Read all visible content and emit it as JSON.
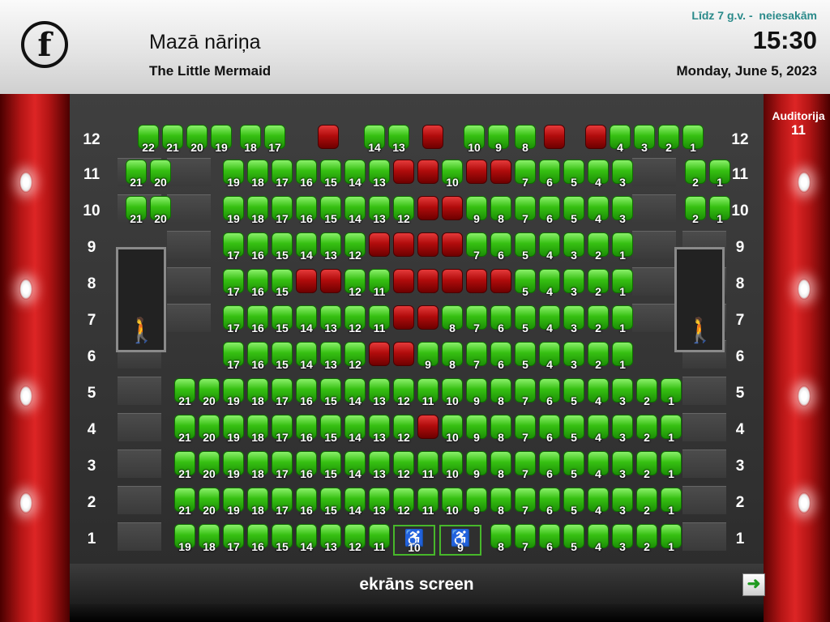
{
  "header": {
    "logo_letter": "f",
    "title_lv": "Mazā nāriņa",
    "title_en": "The Little Mermaid",
    "age_rating": "Līdz 7 g.v. -  neiesakām",
    "time": "15:30",
    "date": "Monday, June 5, 2023"
  },
  "auditorium": {
    "label": "Auditorija",
    "number": "11"
  },
  "screen_label": "ekrāns screen",
  "next_icon": "arrow-right-icon",
  "colors": {
    "available": "#36c012",
    "taken": "#b10c0c",
    "accent": "#2a8a8a"
  },
  "rows": [
    {
      "row": "12",
      "seats": [
        {
          "n": "22",
          "s": "free"
        },
        {
          "n": "21",
          "s": "free"
        },
        {
          "n": "20",
          "s": "free"
        },
        {
          "n": "19",
          "s": "free"
        },
        {
          "n": "18",
          "s": "free"
        },
        {
          "n": "17",
          "s": "free"
        },
        {
          "n": "",
          "s": "taken"
        },
        {
          "n": "14",
          "s": "free"
        },
        {
          "n": "13",
          "s": "free"
        },
        {
          "n": "",
          "s": "taken"
        },
        {
          "n": "10",
          "s": "free"
        },
        {
          "n": "9",
          "s": "free"
        },
        {
          "n": "8",
          "s": "free"
        },
        {
          "n": "",
          "s": "taken"
        },
        {
          "n": "",
          "s": "taken"
        },
        {
          "n": "4",
          "s": "free"
        },
        {
          "n": "3",
          "s": "free"
        },
        {
          "n": "2",
          "s": "free"
        },
        {
          "n": "1",
          "s": "free"
        }
      ]
    },
    {
      "row": "11",
      "seats": [
        {
          "n": "21",
          "s": "free"
        },
        {
          "n": "20",
          "s": "free"
        },
        {
          "n": "19",
          "s": "free"
        },
        {
          "n": "18",
          "s": "free"
        },
        {
          "n": "17",
          "s": "free"
        },
        {
          "n": "16",
          "s": "free"
        },
        {
          "n": "15",
          "s": "free"
        },
        {
          "n": "14",
          "s": "free"
        },
        {
          "n": "13",
          "s": "free"
        },
        {
          "n": "",
          "s": "taken"
        },
        {
          "n": "",
          "s": "taken"
        },
        {
          "n": "10",
          "s": "free"
        },
        {
          "n": "",
          "s": "taken"
        },
        {
          "n": "",
          "s": "taken"
        },
        {
          "n": "7",
          "s": "free"
        },
        {
          "n": "6",
          "s": "free"
        },
        {
          "n": "5",
          "s": "free"
        },
        {
          "n": "4",
          "s": "free"
        },
        {
          "n": "3",
          "s": "free"
        },
        {
          "n": "2",
          "s": "free"
        },
        {
          "n": "1",
          "s": "free"
        }
      ]
    },
    {
      "row": "10",
      "seats": [
        {
          "n": "21",
          "s": "free"
        },
        {
          "n": "20",
          "s": "free"
        },
        {
          "n": "19",
          "s": "free"
        },
        {
          "n": "18",
          "s": "free"
        },
        {
          "n": "17",
          "s": "free"
        },
        {
          "n": "16",
          "s": "free"
        },
        {
          "n": "15",
          "s": "free"
        },
        {
          "n": "14",
          "s": "free"
        },
        {
          "n": "13",
          "s": "free"
        },
        {
          "n": "12",
          "s": "free"
        },
        {
          "n": "",
          "s": "taken"
        },
        {
          "n": "",
          "s": "taken"
        },
        {
          "n": "9",
          "s": "free"
        },
        {
          "n": "8",
          "s": "free"
        },
        {
          "n": "7",
          "s": "free"
        },
        {
          "n": "6",
          "s": "free"
        },
        {
          "n": "5",
          "s": "free"
        },
        {
          "n": "4",
          "s": "free"
        },
        {
          "n": "3",
          "s": "free"
        },
        {
          "n": "2",
          "s": "free"
        },
        {
          "n": "1",
          "s": "free"
        }
      ]
    },
    {
      "row": "9",
      "seats": [
        {
          "n": "17",
          "s": "free"
        },
        {
          "n": "16",
          "s": "free"
        },
        {
          "n": "15",
          "s": "free"
        },
        {
          "n": "14",
          "s": "free"
        },
        {
          "n": "13",
          "s": "free"
        },
        {
          "n": "12",
          "s": "free"
        },
        {
          "n": "",
          "s": "taken"
        },
        {
          "n": "",
          "s": "taken"
        },
        {
          "n": "",
          "s": "taken"
        },
        {
          "n": "",
          "s": "taken"
        },
        {
          "n": "7",
          "s": "free"
        },
        {
          "n": "6",
          "s": "free"
        },
        {
          "n": "5",
          "s": "free"
        },
        {
          "n": "4",
          "s": "free"
        },
        {
          "n": "3",
          "s": "free"
        },
        {
          "n": "2",
          "s": "free"
        },
        {
          "n": "1",
          "s": "free"
        }
      ]
    },
    {
      "row": "8",
      "seats": [
        {
          "n": "17",
          "s": "free"
        },
        {
          "n": "16",
          "s": "free"
        },
        {
          "n": "15",
          "s": "free"
        },
        {
          "n": "",
          "s": "taken"
        },
        {
          "n": "",
          "s": "taken"
        },
        {
          "n": "12",
          "s": "free"
        },
        {
          "n": "11",
          "s": "free"
        },
        {
          "n": "",
          "s": "taken"
        },
        {
          "n": "",
          "s": "taken"
        },
        {
          "n": "",
          "s": "taken"
        },
        {
          "n": "",
          "s": "taken"
        },
        {
          "n": "",
          "s": "taken"
        },
        {
          "n": "5",
          "s": "free"
        },
        {
          "n": "4",
          "s": "free"
        },
        {
          "n": "3",
          "s": "free"
        },
        {
          "n": "2",
          "s": "free"
        },
        {
          "n": "1",
          "s": "free"
        }
      ]
    },
    {
      "row": "7",
      "seats": [
        {
          "n": "17",
          "s": "free"
        },
        {
          "n": "16",
          "s": "free"
        },
        {
          "n": "15",
          "s": "free"
        },
        {
          "n": "14",
          "s": "free"
        },
        {
          "n": "13",
          "s": "free"
        },
        {
          "n": "12",
          "s": "free"
        },
        {
          "n": "11",
          "s": "free"
        },
        {
          "n": "",
          "s": "taken"
        },
        {
          "n": "",
          "s": "taken"
        },
        {
          "n": "8",
          "s": "free"
        },
        {
          "n": "7",
          "s": "free"
        },
        {
          "n": "6",
          "s": "free"
        },
        {
          "n": "5",
          "s": "free"
        },
        {
          "n": "4",
          "s": "free"
        },
        {
          "n": "3",
          "s": "free"
        },
        {
          "n": "2",
          "s": "free"
        },
        {
          "n": "1",
          "s": "free"
        }
      ]
    },
    {
      "row": "6",
      "seats": [
        {
          "n": "17",
          "s": "free"
        },
        {
          "n": "16",
          "s": "free"
        },
        {
          "n": "15",
          "s": "free"
        },
        {
          "n": "14",
          "s": "free"
        },
        {
          "n": "13",
          "s": "free"
        },
        {
          "n": "12",
          "s": "free"
        },
        {
          "n": "",
          "s": "taken"
        },
        {
          "n": "",
          "s": "taken"
        },
        {
          "n": "9",
          "s": "free"
        },
        {
          "n": "8",
          "s": "free"
        },
        {
          "n": "7",
          "s": "free"
        },
        {
          "n": "6",
          "s": "free"
        },
        {
          "n": "5",
          "s": "free"
        },
        {
          "n": "4",
          "s": "free"
        },
        {
          "n": "3",
          "s": "free"
        },
        {
          "n": "2",
          "s": "free"
        },
        {
          "n": "1",
          "s": "free"
        }
      ]
    },
    {
      "row": "5",
      "seats": [
        {
          "n": "21",
          "s": "free"
        },
        {
          "n": "20",
          "s": "free"
        },
        {
          "n": "19",
          "s": "free"
        },
        {
          "n": "18",
          "s": "free"
        },
        {
          "n": "17",
          "s": "free"
        },
        {
          "n": "16",
          "s": "free"
        },
        {
          "n": "15",
          "s": "free"
        },
        {
          "n": "14",
          "s": "free"
        },
        {
          "n": "13",
          "s": "free"
        },
        {
          "n": "12",
          "s": "free"
        },
        {
          "n": "11",
          "s": "free"
        },
        {
          "n": "10",
          "s": "free"
        },
        {
          "n": "9",
          "s": "free"
        },
        {
          "n": "8",
          "s": "free"
        },
        {
          "n": "7",
          "s": "free"
        },
        {
          "n": "6",
          "s": "free"
        },
        {
          "n": "5",
          "s": "free"
        },
        {
          "n": "4",
          "s": "free"
        },
        {
          "n": "3",
          "s": "free"
        },
        {
          "n": "2",
          "s": "free"
        },
        {
          "n": "1",
          "s": "free"
        }
      ]
    },
    {
      "row": "4",
      "seats": [
        {
          "n": "21",
          "s": "free"
        },
        {
          "n": "20",
          "s": "free"
        },
        {
          "n": "19",
          "s": "free"
        },
        {
          "n": "18",
          "s": "free"
        },
        {
          "n": "17",
          "s": "free"
        },
        {
          "n": "16",
          "s": "free"
        },
        {
          "n": "15",
          "s": "free"
        },
        {
          "n": "14",
          "s": "free"
        },
        {
          "n": "13",
          "s": "free"
        },
        {
          "n": "12",
          "s": "free"
        },
        {
          "n": "",
          "s": "taken"
        },
        {
          "n": "10",
          "s": "free"
        },
        {
          "n": "9",
          "s": "free"
        },
        {
          "n": "8",
          "s": "free"
        },
        {
          "n": "7",
          "s": "free"
        },
        {
          "n": "6",
          "s": "free"
        },
        {
          "n": "5",
          "s": "free"
        },
        {
          "n": "4",
          "s": "free"
        },
        {
          "n": "3",
          "s": "free"
        },
        {
          "n": "2",
          "s": "free"
        },
        {
          "n": "1",
          "s": "free"
        }
      ]
    },
    {
      "row": "3",
      "seats": [
        {
          "n": "21",
          "s": "free"
        },
        {
          "n": "20",
          "s": "free"
        },
        {
          "n": "19",
          "s": "free"
        },
        {
          "n": "18",
          "s": "free"
        },
        {
          "n": "17",
          "s": "free"
        },
        {
          "n": "16",
          "s": "free"
        },
        {
          "n": "15",
          "s": "free"
        },
        {
          "n": "14",
          "s": "free"
        },
        {
          "n": "13",
          "s": "free"
        },
        {
          "n": "12",
          "s": "free"
        },
        {
          "n": "11",
          "s": "free"
        },
        {
          "n": "10",
          "s": "free"
        },
        {
          "n": "9",
          "s": "free"
        },
        {
          "n": "8",
          "s": "free"
        },
        {
          "n": "7",
          "s": "free"
        },
        {
          "n": "6",
          "s": "free"
        },
        {
          "n": "5",
          "s": "free"
        },
        {
          "n": "4",
          "s": "free"
        },
        {
          "n": "3",
          "s": "free"
        },
        {
          "n": "2",
          "s": "free"
        },
        {
          "n": "1",
          "s": "free"
        }
      ]
    },
    {
      "row": "2",
      "seats": [
        {
          "n": "21",
          "s": "free"
        },
        {
          "n": "20",
          "s": "free"
        },
        {
          "n": "19",
          "s": "free"
        },
        {
          "n": "18",
          "s": "free"
        },
        {
          "n": "17",
          "s": "free"
        },
        {
          "n": "16",
          "s": "free"
        },
        {
          "n": "15",
          "s": "free"
        },
        {
          "n": "14",
          "s": "free"
        },
        {
          "n": "13",
          "s": "free"
        },
        {
          "n": "12",
          "s": "free"
        },
        {
          "n": "11",
          "s": "free"
        },
        {
          "n": "10",
          "s": "free"
        },
        {
          "n": "9",
          "s": "free"
        },
        {
          "n": "8",
          "s": "free"
        },
        {
          "n": "7",
          "s": "free"
        },
        {
          "n": "6",
          "s": "free"
        },
        {
          "n": "5",
          "s": "free"
        },
        {
          "n": "4",
          "s": "free"
        },
        {
          "n": "3",
          "s": "free"
        },
        {
          "n": "2",
          "s": "free"
        },
        {
          "n": "1",
          "s": "free"
        }
      ]
    },
    {
      "row": "1",
      "seats": [
        {
          "n": "19",
          "s": "free"
        },
        {
          "n": "18",
          "s": "free"
        },
        {
          "n": "17",
          "s": "free"
        },
        {
          "n": "16",
          "s": "free"
        },
        {
          "n": "15",
          "s": "free"
        },
        {
          "n": "14",
          "s": "free"
        },
        {
          "n": "13",
          "s": "free"
        },
        {
          "n": "12",
          "s": "free"
        },
        {
          "n": "11",
          "s": "free"
        },
        {
          "n": "10",
          "s": "wheel"
        },
        {
          "n": "9",
          "s": "wheel"
        },
        {
          "n": "8",
          "s": "free"
        },
        {
          "n": "7",
          "s": "free"
        },
        {
          "n": "6",
          "s": "free"
        },
        {
          "n": "5",
          "s": "free"
        },
        {
          "n": "4",
          "s": "free"
        },
        {
          "n": "3",
          "s": "free"
        },
        {
          "n": "2",
          "s": "free"
        },
        {
          "n": "1",
          "s": "free"
        }
      ]
    }
  ]
}
